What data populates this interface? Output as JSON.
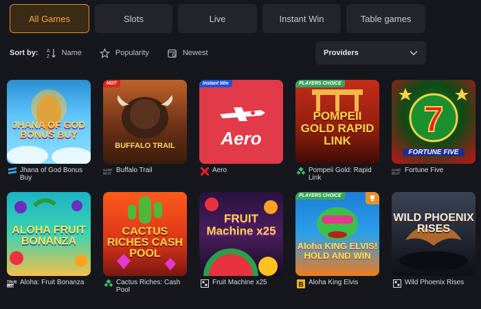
{
  "tabs": [
    {
      "label": "All Games",
      "active": true
    },
    {
      "label": "Slots",
      "active": false
    },
    {
      "label": "Live",
      "active": false
    },
    {
      "label": "Instant Win",
      "active": false
    },
    {
      "label": "Table games",
      "active": false
    }
  ],
  "sort": {
    "label": "Sort by:",
    "options": [
      {
        "label": "Name",
        "icon": "sort-az-icon"
      },
      {
        "label": "Popularity",
        "icon": "star-outline-icon"
      },
      {
        "label": "Newest",
        "icon": "calendar-icon"
      }
    ]
  },
  "providers": {
    "label": "Providers",
    "icon": "chevron-down-icon"
  },
  "games": [
    {
      "name": "Jhana of God Bonus Buy",
      "badge": "",
      "provider_icon": "stripes-provider-icon",
      "art": "JHANA OF GOD BONUS BUY"
    },
    {
      "name": "Buffalo Trail",
      "badge": "HOT",
      "provider_icon": "gamebeat-provider-icon",
      "art": "BUFFALO TRAIL"
    },
    {
      "name": "Aero",
      "badge": "Instant Win",
      "provider_icon": "x-provider-icon",
      "art": "Aero"
    },
    {
      "name": "Pompeii Gold: Rapid Link",
      "badge": "PLAYERS CHOICE",
      "provider_icon": "diamond-provider-icon",
      "art": "POMPEII GOLD RAPID LINK"
    },
    {
      "name": "Fortune Five",
      "badge": "",
      "provider_icon": "gamebeat-provider-icon",
      "art": "FORTUNE FIVE"
    },
    {
      "name": "Aloha: Fruit Bonanza",
      "badge": "",
      "provider_icon": "truelab-provider-icon",
      "art": "ALOHA FRUIT BONANZA"
    },
    {
      "name": "Cactus Riches: Cash Pool",
      "badge": "",
      "provider_icon": "diamond-provider-icon",
      "art": "CACTUS RICHES CASH POOL"
    },
    {
      "name": "Fruit Machine x25",
      "badge": "",
      "provider_icon": "grid-provider-icon",
      "art": "FRUIT Machine x25"
    },
    {
      "name": "Aloha King Elvis",
      "badge": "PLAYERS CHOICE",
      "provider_icon": "b-provider-icon",
      "art": "Aloha KING ELVIS! HOLD AND WIN"
    },
    {
      "name": "Wild Phoenix Rises",
      "badge": "",
      "provider_icon": "grid-provider-icon",
      "art": "WILD PHOENIX RISES"
    }
  ],
  "colors": {
    "accent": "#e6932a",
    "background": "#16171d",
    "tab_bg": "#23242c",
    "badge_hot": "#d6281e",
    "badge_instant": "#2251d6",
    "badge_players_choice": "#3aa35a"
  }
}
